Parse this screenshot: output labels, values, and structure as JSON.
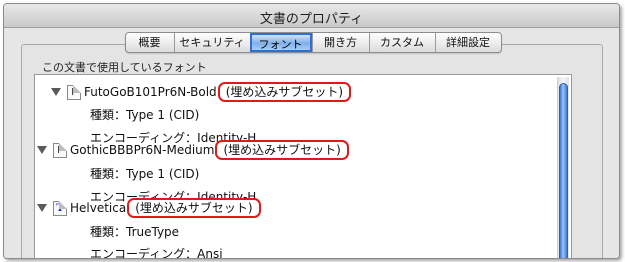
{
  "window": {
    "title": "文書のプロパティ"
  },
  "tabs": [
    {
      "label": "概要"
    },
    {
      "label": "セキュリティ"
    },
    {
      "label": "フォント"
    },
    {
      "label": "開き方"
    },
    {
      "label": "カスタム"
    },
    {
      "label": "詳細設定"
    }
  ],
  "active_tab": "フォント",
  "fonts_section": {
    "label": "この文書で使用しているフォント"
  },
  "fonts": [
    {
      "name": "FutoGoB101Pr6N-Bold",
      "embed_status": "(埋め込みサブセット)",
      "icon": "font-file-icon",
      "type_line": "種類：Type 1 (CID)",
      "encoding_line": "エンコーディング：Identity-H"
    },
    {
      "name": "GothicBBBPr6N-Medium",
      "embed_status": "(埋め込みサブセット)",
      "icon": "font-file-icon",
      "type_line": "種類：Type 1 (CID)",
      "encoding_line": "エンコーディング：Identity-H"
    },
    {
      "name": "Helvetica",
      "embed_status": "(埋め込みサブセット)",
      "icon": "truetype-icon",
      "type_line": "種類：TrueType",
      "encoding_line": "エンコーディング：Ansi"
    }
  ],
  "colors": {
    "highlight_outline": "#e11919",
    "active_tab": "#6fa6ea",
    "scroll_thumb": "#3a74d6"
  }
}
